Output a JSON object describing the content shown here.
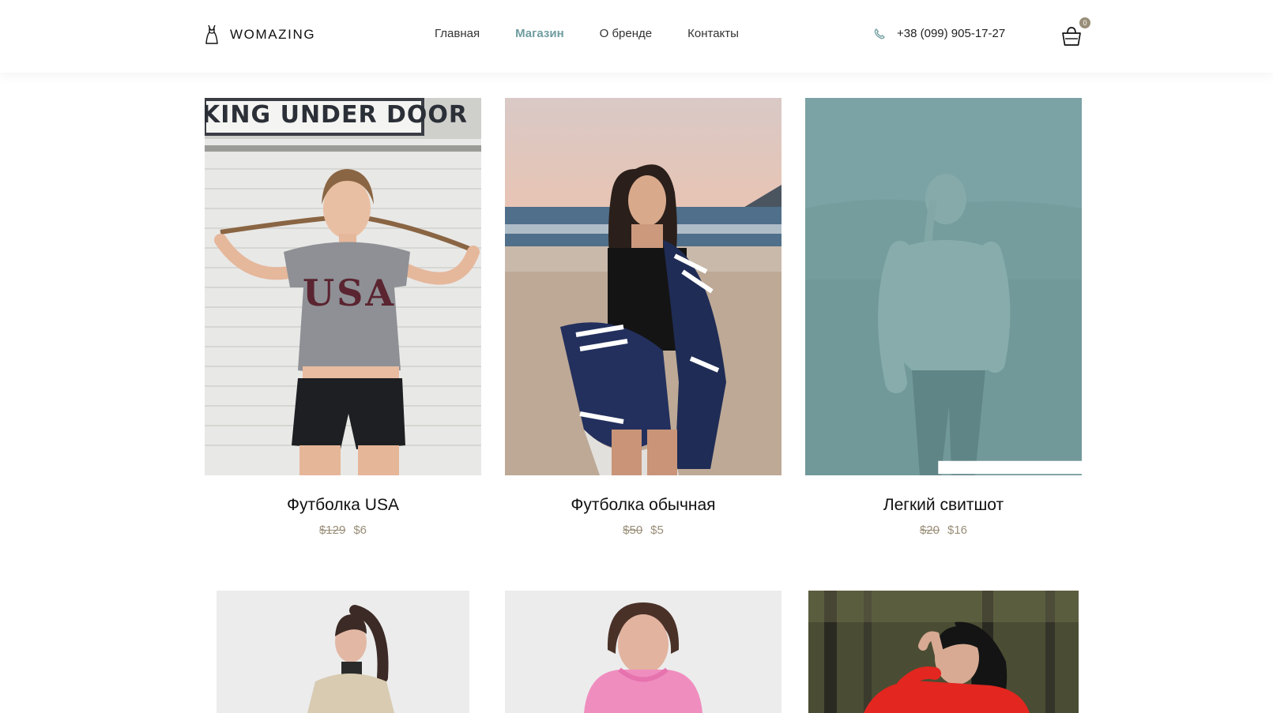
{
  "brand": {
    "name": "WOMAZING"
  },
  "nav": [
    {
      "label": "Главная",
      "active": false
    },
    {
      "label": "Магазин",
      "active": true
    },
    {
      "label": "О бренде",
      "active": false
    },
    {
      "label": "Контакты",
      "active": false
    }
  ],
  "contact": {
    "phone": "+38 (099) 905-17-27",
    "icon": "phone-icon"
  },
  "cart": {
    "count": "0",
    "icon": "shopping-basket-icon"
  },
  "colors": {
    "accent": "#6e9c9f",
    "price": "#998e78",
    "overlay": "#6f9e9f"
  },
  "products": [
    {
      "name": "Футболка USA",
      "old_price": "$129",
      "price": "$6"
    },
    {
      "name": "Футболка обычная",
      "old_price": "$50",
      "price": "$5"
    },
    {
      "name": "Легкий свитшот",
      "old_price": "$20",
      "price": "$16",
      "hovered": true,
      "overlay_icon": "arrow-right-icon"
    },
    {
      "name": "",
      "old_price": "",
      "price": ""
    },
    {
      "name": "",
      "old_price": "",
      "price": ""
    },
    {
      "name": "",
      "old_price": "",
      "price": ""
    }
  ],
  "sign_text": "KING UNDER DOOR"
}
